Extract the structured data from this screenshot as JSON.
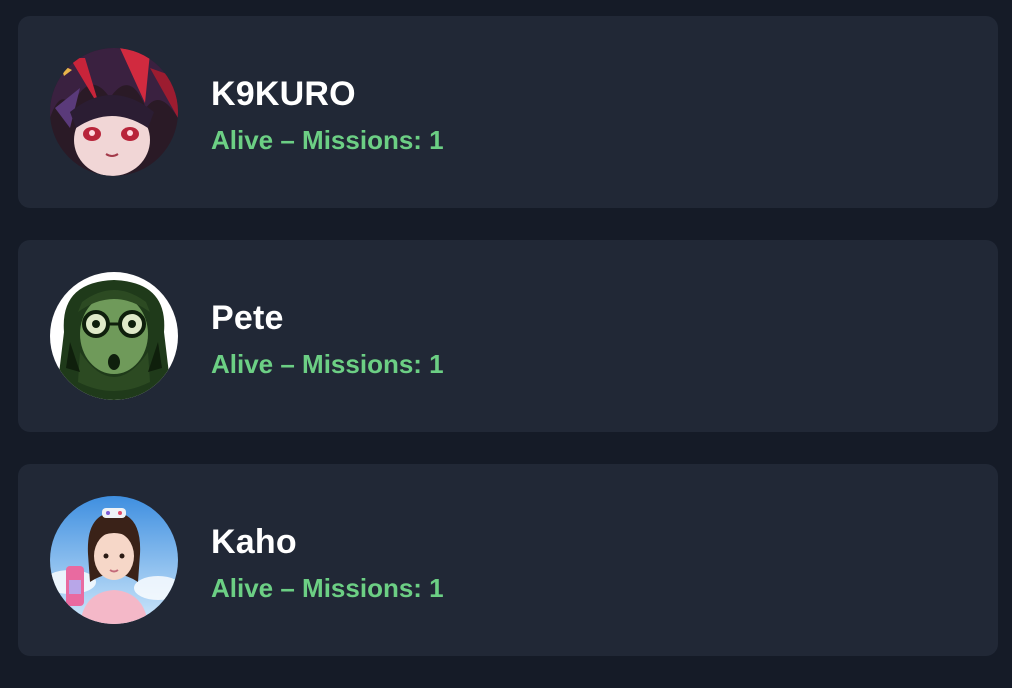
{
  "colors": {
    "page_background": "#151b27",
    "card_background": "#212836",
    "name_text": "#ffffff",
    "status_alive": "#6ccf84"
  },
  "players": [
    {
      "name": "K9KURO",
      "status": "Alive – Missions: 1",
      "avatar_icon": "anime-character-avatar"
    },
    {
      "name": "Pete",
      "status": "Alive – Missions: 1",
      "avatar_icon": "green-bearded-man-avatar"
    },
    {
      "name": "Kaho",
      "status": "Alive – Missions: 1",
      "avatar_icon": "girl-photo-avatar"
    }
  ]
}
